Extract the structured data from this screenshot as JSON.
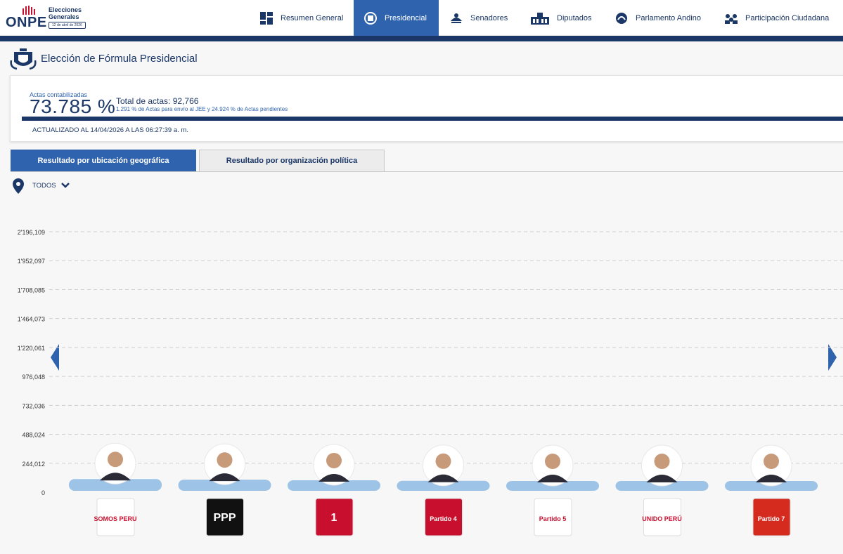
{
  "header": {
    "logo_text": "ONPE",
    "election_line1": "Elecciones",
    "election_line2": "Generales",
    "election_date": "12 de abril de 2026",
    "nav": [
      {
        "label": "Resumen General",
        "icon": "dashboard-icon",
        "active": false
      },
      {
        "label": "Presidencial",
        "icon": "presidential-crest-icon",
        "active": true
      },
      {
        "label": "Senadores",
        "icon": "senators-icon",
        "active": false
      },
      {
        "label": "Diputados",
        "icon": "congress-building-icon",
        "active": false
      },
      {
        "label": "Parlamento Andino",
        "icon": "andean-parliament-icon",
        "active": false
      },
      {
        "label": "Participación Ciudadana",
        "icon": "citizens-icon",
        "active": false
      }
    ]
  },
  "page": {
    "title": "Elección de Fórmula Presidencial"
  },
  "summary": {
    "actas_label": "Actas contabilizadas",
    "actas_pct": "73.785 %",
    "actas_fraction": 0.73785,
    "total_label": "Total de actas: 92,766",
    "sub_label": "1.291 % de Actas para envío al JEE y 24.924 % de Actas pendientes",
    "updated": "ACTUALIZADO AL 14/04/2026 A LAS 06:27:39 a. m."
  },
  "tabs": {
    "geo": "Resultado por ubicación geográfica",
    "org": "Resultado por organización política"
  },
  "filter": {
    "value": "TODOS"
  },
  "colors": {
    "navy": "#1b3767",
    "accent_blue": "#2f63ad",
    "bar": "#9dc3e6"
  },
  "chart_data": {
    "type": "bar",
    "y_tick_labels": [
      "0",
      "244,012",
      "488,024",
      "732,036",
      "976,048",
      "1'220,061",
      "1'464,073",
      "1'708,085",
      "1'952,097",
      "2'196,109"
    ],
    "ylim": [
      0,
      2196109
    ],
    "grid": true,
    "categories": [
      "SOMOS PERU",
      "PPP",
      "1",
      "Partido 4",
      "Partido 5",
      "UNIDO PERÚ",
      "Partido 7"
    ],
    "values": [
      105000,
      100000,
      95000,
      90000,
      85000,
      80000,
      70000
    ]
  }
}
